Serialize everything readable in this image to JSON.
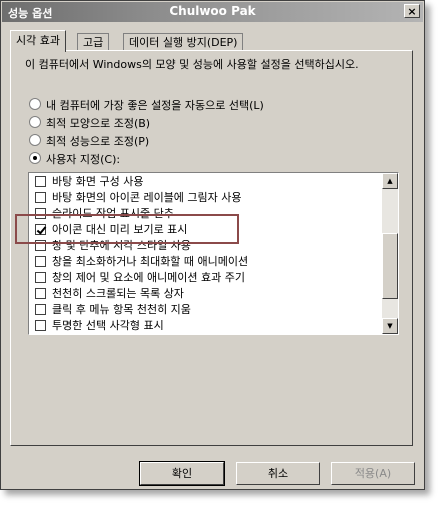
{
  "window": {
    "title_left": "성능 옵션",
    "title_center": "Chulwoo Pak",
    "close_glyph": "×"
  },
  "tabs": [
    {
      "label": "시각 효과"
    },
    {
      "label": "고급"
    },
    {
      "label": "데이터 실행 방지(DEP)"
    }
  ],
  "description": "이 컴퓨터에서 Windows의 모양 및 성능에 사용할 설정을 선택하십시오.",
  "options": [
    {
      "label": "내 컴퓨터에 가장 좋은 설정을 자동으로 선택(L)",
      "selected": false
    },
    {
      "label": "최적 모양으로 조정(B)",
      "selected": false
    },
    {
      "label": "최적 성능으로 조정(P)",
      "selected": false
    },
    {
      "label": "사용자 지정(C):",
      "selected": true
    }
  ],
  "effects": [
    {
      "label": "바탕 화면 구성 사용",
      "checked": false
    },
    {
      "label": "바탕 화면의 아이콘 레이블에 그림자 사용",
      "checked": false
    },
    {
      "label": "슬라이드 작업 표시줄 단추",
      "checked": false
    },
    {
      "label": "아이콘 대신 미리 보기로 표시",
      "checked": true
    },
    {
      "label": "창 및 단추에 시각 스타일 사용",
      "checked": false
    },
    {
      "label": "창을 최소화하거나 최대화할 때 애니메이션",
      "checked": false
    },
    {
      "label": "창의 제어 및 요소에 애니메이션 효과 주기",
      "checked": false
    },
    {
      "label": "천천히 스크롤되는 목록 상자",
      "checked": false
    },
    {
      "label": "클릭 후 메뉴 항목 천천히 지움",
      "checked": false
    },
    {
      "label": "투명한 선택 사각형 표시",
      "checked": false
    }
  ],
  "buttons": {
    "ok": "확인",
    "cancel": "취소",
    "apply": "적용(A)"
  },
  "scroll": {
    "up_glyph": "▲",
    "down_glyph": "▼"
  }
}
